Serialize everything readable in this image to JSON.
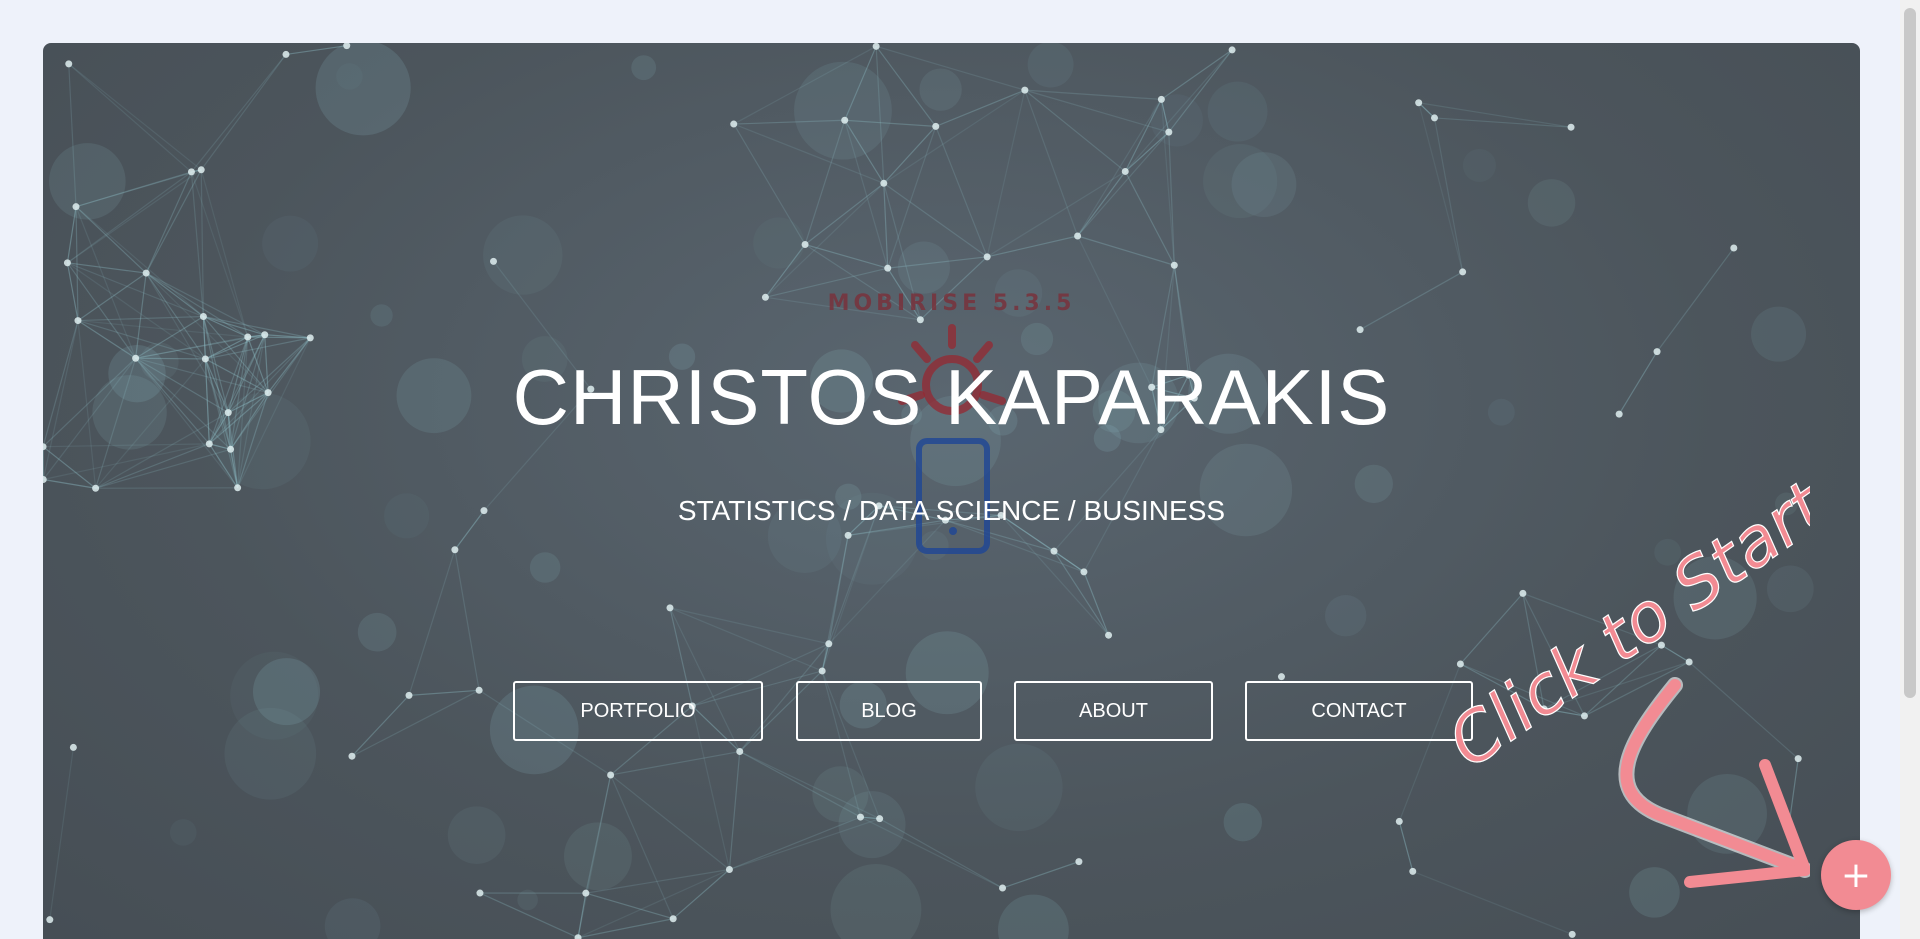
{
  "badge": {
    "text": "MOBIRISE 5.3.5"
  },
  "hero": {
    "title": "CHRISTOS KAPARAKIS",
    "subtitle": "STATISTICS / DATA SCIENCE / BUSINESS"
  },
  "nav_buttons": [
    {
      "label": "PORTFOLIO"
    },
    {
      "label": "BLOG"
    },
    {
      "label": "ABOUT"
    },
    {
      "label": "CONTACT"
    }
  ],
  "cta": {
    "text": "Click to Start",
    "arrow_icon": "curved-arrow-icon"
  },
  "fab": {
    "icon": "plus-icon",
    "glyph": "+"
  },
  "colors": {
    "accent": "#f28b93",
    "background": "#eef2fa",
    "hero_overlay": "#4c555c",
    "network": "#8fc0c8"
  }
}
